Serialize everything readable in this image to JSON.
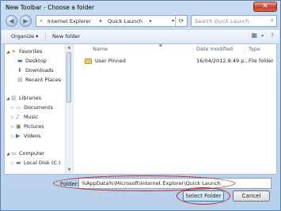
{
  "window": {
    "title": "New Toolbar - Choose a folder",
    "close_symbol": "✕"
  },
  "address": {
    "parts": [
      "Internet Explorer",
      "Quick Launch"
    ],
    "prefix": "«",
    "separator": "▸",
    "search_placeholder": "Search Quick Launch"
  },
  "toolbar": {
    "organize": "Organize ▾",
    "new_folder": "New folder"
  },
  "nav": {
    "favorites": "Favorites",
    "desktop": "Desktop",
    "downloads": "Downloads",
    "recent_places": "Recent Places",
    "libraries": "Libraries",
    "documents": "Documents",
    "music": "Music",
    "pictures": "Pictures",
    "videos": "Videos",
    "computer": "Computer",
    "local_disk": "Local Disk (C:)"
  },
  "columns": {
    "name": "Name",
    "date_modified": "Date modified",
    "type": "Type"
  },
  "files": [
    {
      "name": "User Pinned",
      "date": "16/04/2012 9:49 p...",
      "type": "File folder"
    }
  ],
  "folder": {
    "label": "Folder:",
    "value": "%AppData%\\Microsoft\\Internet Explorer\\Quick Launch"
  },
  "buttons": {
    "select": "Select Folder",
    "cancel": "Cancel"
  },
  "colors": {
    "highlight_circle": "#c91d1d",
    "title_bar": "#c9dcf1"
  },
  "icons": [
    "back-icon",
    "forward-icon",
    "refresh-icon",
    "search-icon",
    "folder-icon",
    "star-icon",
    "library-icon",
    "computer-icon",
    "disk-icon"
  ]
}
